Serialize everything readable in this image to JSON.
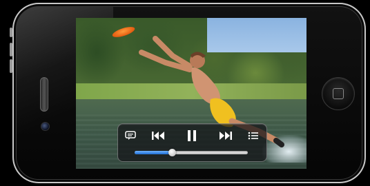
{
  "device": {
    "name": "iPhone",
    "body_color": "#0b0b0b",
    "bezel_color": "#c9c9c9"
  },
  "video": {
    "scene": "photo",
    "frisbee_color": "#ff7a1a",
    "shorts_color": "#f0c020"
  },
  "player": {
    "controls": [
      {
        "name": "subtitles",
        "icon": "speech-bubble-icon"
      },
      {
        "name": "previous",
        "icon": "skip-back-icon"
      },
      {
        "name": "pause",
        "icon": "pause-icon"
      },
      {
        "name": "next",
        "icon": "skip-forward-icon"
      },
      {
        "name": "chapters",
        "icon": "list-icon"
      }
    ],
    "progress": 0.33,
    "accent_color": "#2a7de1"
  }
}
